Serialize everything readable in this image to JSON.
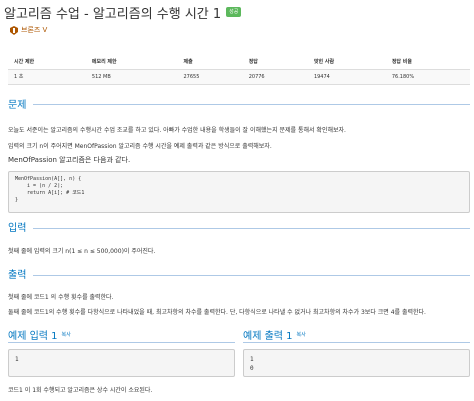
{
  "header": {
    "title": "알고리즘 수업 - 알고리즘의 수행 시간 1",
    "badge": "성공",
    "tier_label": "브론즈 V",
    "tier_color": "#ad5600"
  },
  "info_table": {
    "headers": [
      "시간 제한",
      "메모리 제한",
      "제출",
      "정답",
      "맞힌 사람",
      "정답 비율"
    ],
    "values": [
      "1 초",
      "512 MB",
      "27655",
      "20776",
      "19474",
      "76.180%"
    ]
  },
  "problem": {
    "heading": "문제",
    "lines": [
      "오늘도 서준이는 알고리즘의 수행시간 수업 조교를 하고 있다. 아빠가 수업한 내용을 학생들이 잘 이해했는지 문제를 통해서 확인해보자.",
      "입력의 크기 n이 주어지면 MenOfPassion 알고리즘 수행 시간을 예제 출력과 같은 방식으로 출력해보자.",
      "MenOfPassion 알고리즘은 다음과 같다."
    ],
    "code": [
      "MenOfPassion(A[], n) {",
      "    i = ⌊n / 2⌋;",
      "    return A[i]; # 코드1",
      "}"
    ]
  },
  "input": {
    "heading": "입력",
    "line": "첫째 줄에 입력의 크기 n(1 ≤ n ≤ 500,000)이 주어진다."
  },
  "output": {
    "heading": "출력",
    "lines": [
      "첫째 줄에 코드1 의 수행 횟수를 출력한다.",
      "둘째 줄에 코드1의 수행 횟수를 다항식으로 나타내었을 때, 최고차항의 차수를 출력한다. 단, 다항식으로 나타낼 수 없거나 최고차항의 차수가 3보다 크면 4를 출력한다."
    ]
  },
  "samples": {
    "input_heading": "예제 입력 1",
    "output_heading": "예제 출력 1",
    "copy_label": "복사",
    "input_lines": [
      "1"
    ],
    "output_lines": [
      "1",
      "0"
    ]
  },
  "footer_note": "코드1 이 1회 수행되고 알고리즘은 상수 시간이 소요된다.",
  "colors": {
    "accent": "#0076c0",
    "badge": "#5cb85c"
  }
}
